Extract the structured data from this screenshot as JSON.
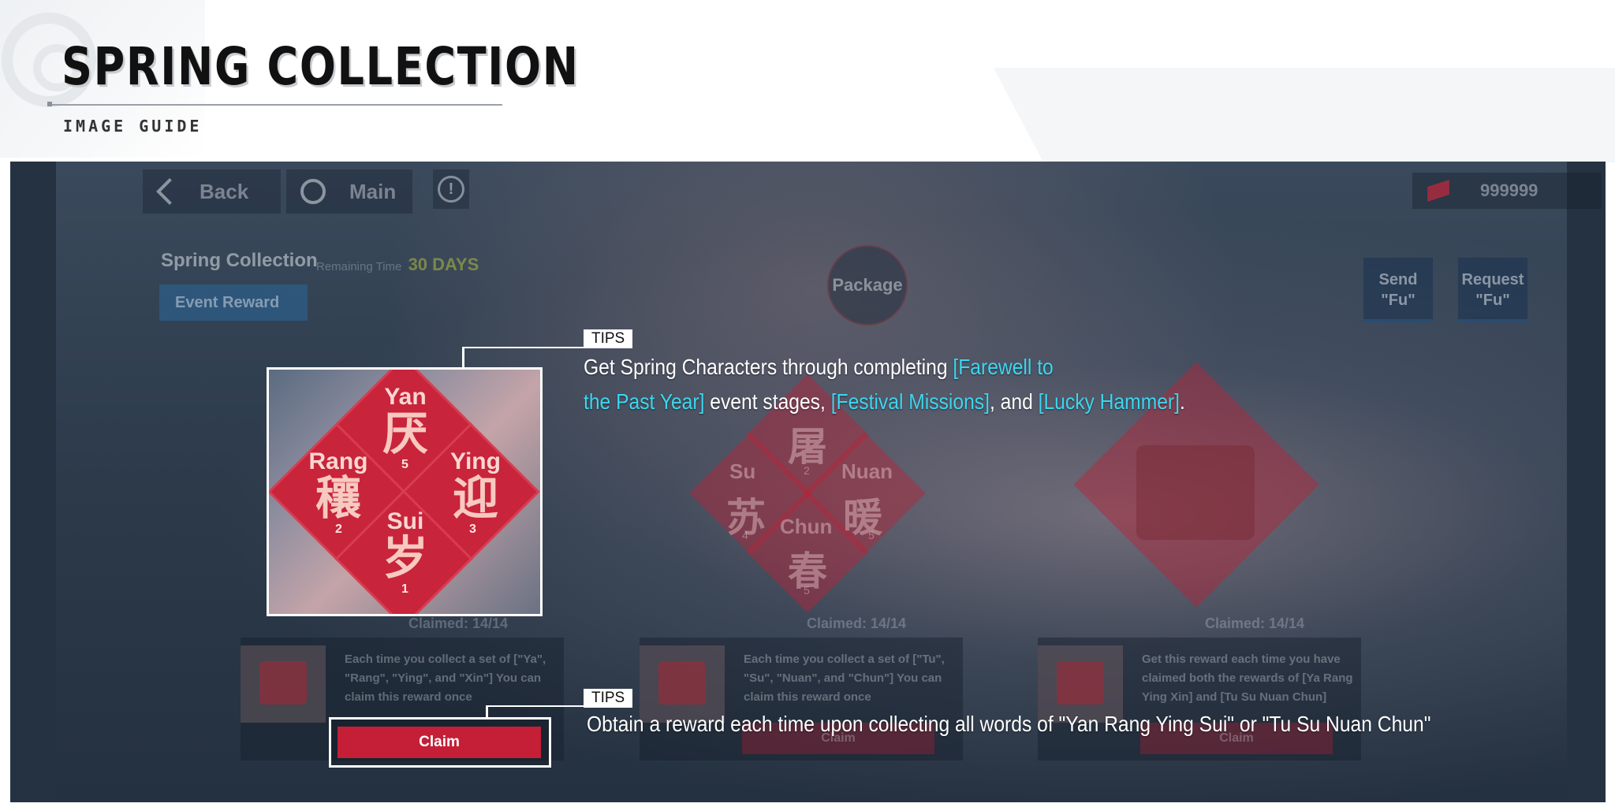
{
  "header": {
    "title": "SPRING COLLECTION",
    "subtitle": "IMAGE GUIDE"
  },
  "topbar": {
    "back_label": "Back",
    "main_label": "Main",
    "info_icon": "!",
    "currency_value": "999999"
  },
  "event": {
    "title": "Spring Collection",
    "remaining_label": "Remaining Time",
    "remaining_value": "30 DAYS",
    "tab_label": "Event Reward",
    "package_label": "Package",
    "send_label": "Send\n\"Fu\"",
    "request_label": "Request\n\"Fu\""
  },
  "sets": [
    {
      "words": [
        {
          "latin": "Yan",
          "cjk": "厌",
          "count": "5"
        },
        {
          "latin": "Rang",
          "cjk": "穰",
          "count": "2"
        },
        {
          "latin": "Ying",
          "cjk": "迎",
          "count": "3"
        },
        {
          "latin": "Sui",
          "cjk": "岁",
          "count": "1"
        }
      ],
      "claimed": "Claimed: 14/14",
      "reward_text": "Each time you collect a set of [\"Ya\", \"Rang\", \"Ying\", and \"Xin\"] You can claim this reward once",
      "claim_label": "Claim"
    },
    {
      "words": [
        {
          "latin": "",
          "cjk": "屠",
          "count": "2"
        },
        {
          "latin": "Su",
          "cjk": "苏",
          "count": "4"
        },
        {
          "latin": "Nuan",
          "cjk": "暖",
          "count": "5"
        },
        {
          "latin": "Chun",
          "cjk": "春",
          "count": "5"
        }
      ],
      "claimed": "Claimed: 14/14",
      "reward_text": "Each time you collect a set of [\"Tu\", \"Su\", \"Nuan\", and \"Chun\"] You can claim this reward once",
      "claim_label": "Claim"
    },
    {
      "claimed": "Claimed: 14/14",
      "reward_text": "Get this reward each time you have claimed both the rewards of [Ya Rang Ying Xin] and [Tu Su Nuan Chun]",
      "claim_label": "Claim"
    }
  ],
  "tips": [
    {
      "tag": "TIPS",
      "line1_a": "Get Spring Characters through completing ",
      "line1_hl": "[Farewell to",
      "line2_hl_a": "the Past Year]",
      "line2_b": " event stages, ",
      "line2_hl_c": "[Festival Missions]",
      "line2_d": ", and ",
      "line2_hl_e": "[Lucky Hammer]",
      "line2_f": "."
    },
    {
      "tag": "TIPS",
      "text": "Obtain a reward each time upon collecting all words of \"Yan Rang Ying Sui\" or \"Tu Su Nuan Chun\""
    }
  ],
  "highlight_claim_label": "Claim",
  "colors": {
    "accent_cyan": "#3dd6f0",
    "claim_red": "#c41f36",
    "diamond_red": "#c8243b"
  }
}
